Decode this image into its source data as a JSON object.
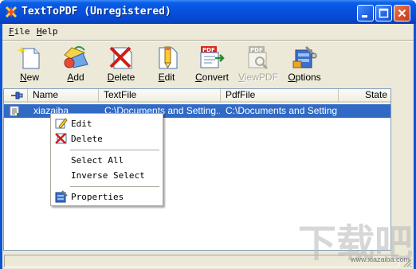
{
  "window": {
    "title": "TextToPDF (Unregistered)",
    "icons": {
      "app": "flash-icon",
      "minimize": "minimize-icon",
      "maximize": "maximize-icon",
      "close": "close-icon"
    }
  },
  "menu": {
    "file": "File",
    "help": "Help"
  },
  "toolbar": {
    "new": "New",
    "add": "Add",
    "delete": "Delete",
    "edit": "Edit",
    "convert": "Convert",
    "viewpdf": "ViewPDF",
    "options": "Options"
  },
  "list": {
    "columns": {
      "name": "Name",
      "textfile": "TextFile",
      "pdffile": "PdfFile",
      "state": "State"
    },
    "rows": [
      {
        "name": "xiazaiba",
        "textfile": "C:\\Documents and Setting...",
        "pdffile": "C:\\Documents and Setting...",
        "state": ""
      }
    ]
  },
  "context_menu": {
    "edit": "Edit",
    "delete": "Delete",
    "select_all": "Select All",
    "inverse_select": "Inverse Select",
    "properties": "Properties"
  },
  "watermark": {
    "text": "下载吧",
    "url": "www.xiazaiba.com"
  },
  "colors": {
    "title_bar": "#0a54d8",
    "selection": "#316ac5",
    "face": "#ece9d8"
  }
}
